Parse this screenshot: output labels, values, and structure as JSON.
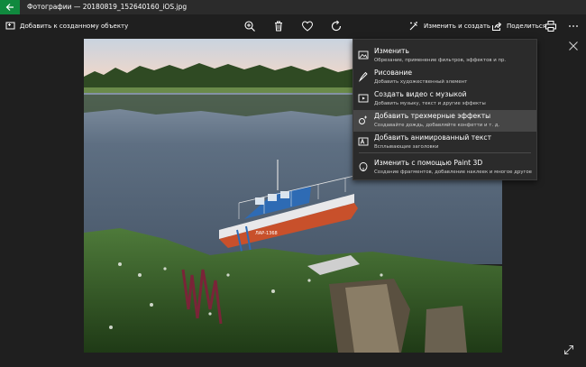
{
  "window": {
    "title": "Фотографии — 20180819_152640160_iOS.jpg"
  },
  "toolbar": {
    "add_to_creation": "Добавить к созданному объекту",
    "edit_create": "Изменить и создать",
    "share": "Поделиться"
  },
  "menu": {
    "items": [
      {
        "title": "Изменить",
        "subtitle": "Обрезание, применение фильтров, эффектов и пр.",
        "icon": "image-edit-icon"
      },
      {
        "title": "Рисование",
        "subtitle": "Добавить художественный элемент",
        "icon": "pen-icon"
      },
      {
        "title": "Создать видео с музыкой",
        "subtitle": "Добавить музыку, текст и другие эффекты",
        "icon": "video-icon"
      },
      {
        "title": "Добавить трехмерные эффекты",
        "subtitle": "Создавайте дождь, добавляйте конфетти и т. д.",
        "icon": "effects-3d-icon"
      },
      {
        "title": "Добавить анимированный текст",
        "subtitle": "Всплывающие заголовки",
        "icon": "animated-text-icon"
      },
      {
        "title": "Изменить с помощью Paint 3D",
        "subtitle": "Создание фрагментов, добавление наклеек и многое другое",
        "icon": "paint3d-icon"
      }
    ],
    "highlighted_index": 3
  },
  "colors": {
    "accent": "#10893e",
    "menu_bg": "#2b2b2b",
    "menu_highlight": "#464646",
    "toolbar_bg": "#1f1f1f"
  },
  "photo": {
    "boat_label": "ЛАР-1368"
  }
}
